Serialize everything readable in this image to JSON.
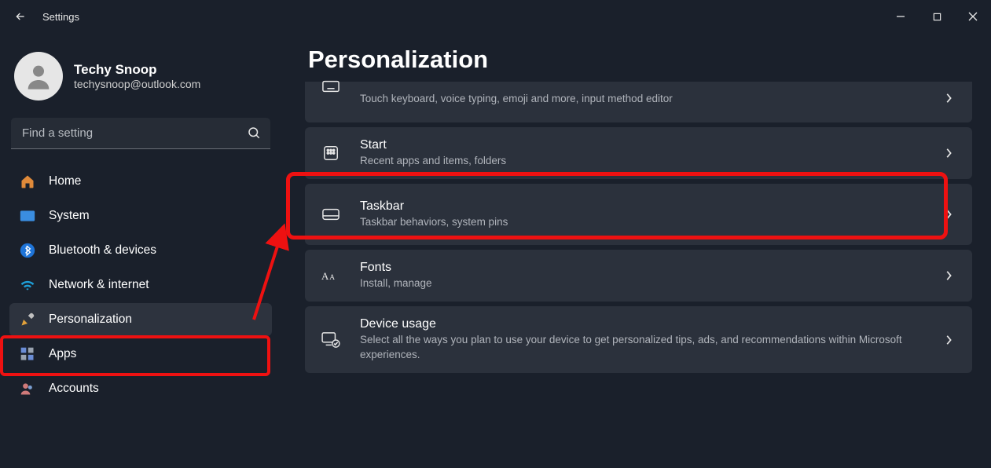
{
  "app": {
    "title": "Settings"
  },
  "account": {
    "name": "Techy Snoop",
    "email": "techysnoop@outlook.com"
  },
  "search": {
    "placeholder": "Find a setting"
  },
  "sidebar": {
    "items": [
      {
        "label": "Home"
      },
      {
        "label": "System"
      },
      {
        "label": "Bluetooth & devices"
      },
      {
        "label": "Network & internet"
      },
      {
        "label": "Personalization"
      },
      {
        "label": "Apps"
      },
      {
        "label": "Accounts"
      }
    ]
  },
  "page": {
    "title": "Personalization"
  },
  "cards": {
    "text_input": {
      "sub": "Touch keyboard, voice typing, emoji and more, input method editor"
    },
    "start": {
      "title": "Start",
      "sub": "Recent apps and items, folders"
    },
    "taskbar": {
      "title": "Taskbar",
      "sub": "Taskbar behaviors, system pins"
    },
    "fonts": {
      "title": "Fonts",
      "sub": "Install, manage"
    },
    "device_usage": {
      "title": "Device usage",
      "sub": "Select all the ways you plan to use your device to get personalized tips, ads, and recommendations within Microsoft experiences."
    }
  }
}
